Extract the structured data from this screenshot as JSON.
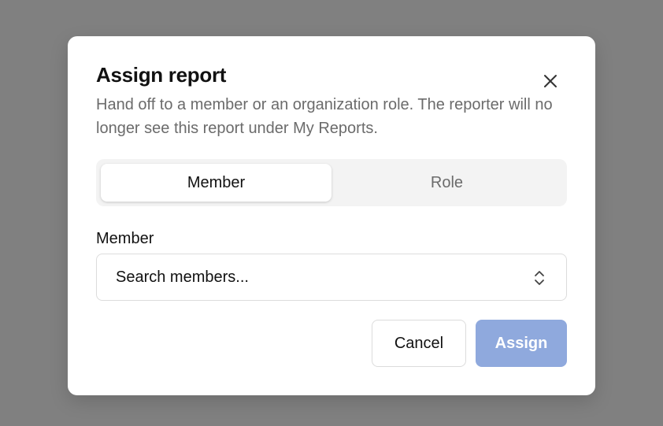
{
  "dialog": {
    "title": "Assign report",
    "description": "Hand off to a member or an organization role. The reporter will no longer see this report under My Reports.",
    "close_icon": "close-icon"
  },
  "assignee_type": {
    "options": [
      {
        "label": "Member",
        "selected": true
      },
      {
        "label": "Role",
        "selected": false
      }
    ]
  },
  "member_field": {
    "label": "Member",
    "placeholder": "Search members...",
    "value": "",
    "icon": "chevron-up-down-icon"
  },
  "actions": {
    "cancel_label": "Cancel",
    "assign_label": "Assign",
    "assign_disabled": true
  },
  "colors": {
    "overlay": "#808080",
    "assign_disabled_bg": "#8fa9dd",
    "secondary_text": "#6b6b6b"
  }
}
